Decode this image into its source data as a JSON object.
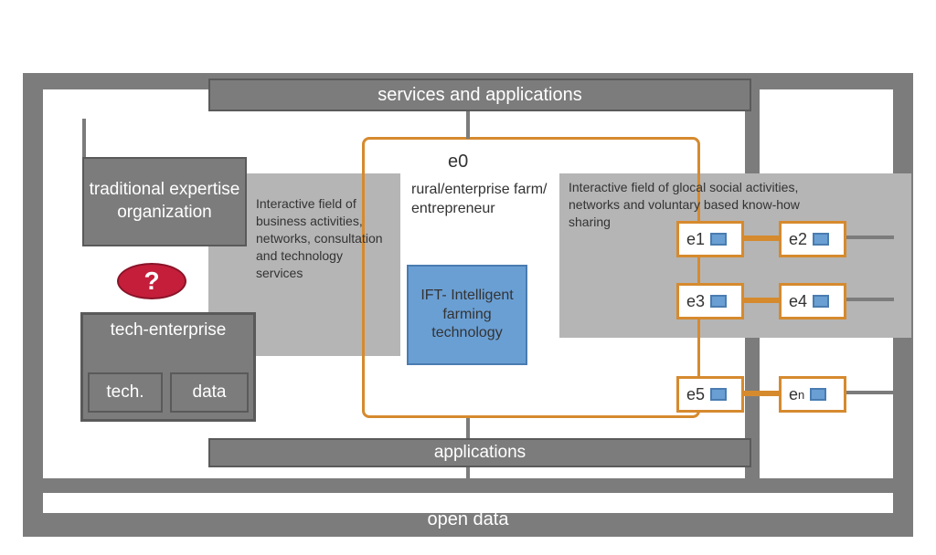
{
  "top_bar": "services and applications",
  "mid_bar": "applications",
  "bottom_bar": "open data",
  "left": {
    "traditional": "traditional expertise organization",
    "question": "?",
    "tech_enterprise": "tech-enterprise",
    "tech": "tech.",
    "data": "data"
  },
  "center_left_text": "Interactive field of business activities, networks, consultation and technology services",
  "center": {
    "e0": "e0",
    "rural": "rural/enterprise farm/ entrepreneur",
    "ift": "IFT- Intelligent farming technology"
  },
  "right_text": "Interactive field of glocal   social activities, networks and voluntary based know-how sharing",
  "nodes": {
    "e1": "e1",
    "e2": "e2",
    "e3": "e3",
    "e4": "e4",
    "e5": "e5",
    "en_e": "e",
    "en_n": "n"
  }
}
